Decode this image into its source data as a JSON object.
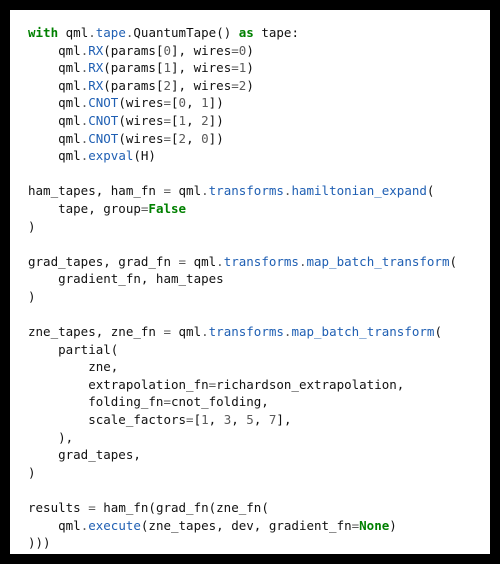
{
  "code": {
    "tokens": [
      [
        [
          "kw",
          "with "
        ],
        [
          "name",
          "qml"
        ],
        [
          "op",
          "."
        ],
        [
          "attr",
          "tape"
        ],
        [
          "op",
          "."
        ],
        [
          "name",
          "QuantumTape"
        ],
        [
          "punc",
          "() "
        ],
        [
          "kw",
          "as"
        ],
        [
          "name",
          " tape"
        ],
        [
          "punc",
          ":"
        ]
      ],
      [
        [
          "name",
          "    qml"
        ],
        [
          "op",
          "."
        ],
        [
          "call",
          "RX"
        ],
        [
          "punc",
          "(params["
        ],
        [
          "num",
          "0"
        ],
        [
          "punc",
          "], wires"
        ],
        [
          "op",
          "="
        ],
        [
          "num",
          "0"
        ],
        [
          "punc",
          ")"
        ]
      ],
      [
        [
          "name",
          "    qml"
        ],
        [
          "op",
          "."
        ],
        [
          "call",
          "RX"
        ],
        [
          "punc",
          "(params["
        ],
        [
          "num",
          "1"
        ],
        [
          "punc",
          "], wires"
        ],
        [
          "op",
          "="
        ],
        [
          "num",
          "1"
        ],
        [
          "punc",
          ")"
        ]
      ],
      [
        [
          "name",
          "    qml"
        ],
        [
          "op",
          "."
        ],
        [
          "call",
          "RX"
        ],
        [
          "punc",
          "(params["
        ],
        [
          "num",
          "2"
        ],
        [
          "punc",
          "], wires"
        ],
        [
          "op",
          "="
        ],
        [
          "num",
          "2"
        ],
        [
          "punc",
          ")"
        ]
      ],
      [
        [
          "name",
          "    qml"
        ],
        [
          "op",
          "."
        ],
        [
          "call",
          "CNOT"
        ],
        [
          "punc",
          "(wires"
        ],
        [
          "op",
          "="
        ],
        [
          "punc",
          "["
        ],
        [
          "num",
          "0"
        ],
        [
          "punc",
          ", "
        ],
        [
          "num",
          "1"
        ],
        [
          "punc",
          "])"
        ]
      ],
      [
        [
          "name",
          "    qml"
        ],
        [
          "op",
          "."
        ],
        [
          "call",
          "CNOT"
        ],
        [
          "punc",
          "(wires"
        ],
        [
          "op",
          "="
        ],
        [
          "punc",
          "["
        ],
        [
          "num",
          "1"
        ],
        [
          "punc",
          ", "
        ],
        [
          "num",
          "2"
        ],
        [
          "punc",
          "])"
        ]
      ],
      [
        [
          "name",
          "    qml"
        ],
        [
          "op",
          "."
        ],
        [
          "call",
          "CNOT"
        ],
        [
          "punc",
          "(wires"
        ],
        [
          "op",
          "="
        ],
        [
          "punc",
          "["
        ],
        [
          "num",
          "2"
        ],
        [
          "punc",
          ", "
        ],
        [
          "num",
          "0"
        ],
        [
          "punc",
          "])"
        ]
      ],
      [
        [
          "name",
          "    qml"
        ],
        [
          "op",
          "."
        ],
        [
          "call",
          "expval"
        ],
        [
          "punc",
          "(H)"
        ]
      ],
      [],
      [
        [
          "name",
          "ham_tapes, ham_fn "
        ],
        [
          "op",
          "="
        ],
        [
          "name",
          " qml"
        ],
        [
          "op",
          "."
        ],
        [
          "attr",
          "transforms"
        ],
        [
          "op",
          "."
        ],
        [
          "call",
          "hamiltonian_expand"
        ],
        [
          "punc",
          "("
        ]
      ],
      [
        [
          "name",
          "    tape, group"
        ],
        [
          "op",
          "="
        ],
        [
          "builtin_bold",
          "False"
        ]
      ],
      [
        [
          "punc",
          ")"
        ]
      ],
      [],
      [
        [
          "name",
          "grad_tapes, grad_fn "
        ],
        [
          "op",
          "="
        ],
        [
          "name",
          " qml"
        ],
        [
          "op",
          "."
        ],
        [
          "attr",
          "transforms"
        ],
        [
          "op",
          "."
        ],
        [
          "call",
          "map_batch_transform"
        ],
        [
          "punc",
          "("
        ]
      ],
      [
        [
          "name",
          "    gradient_fn, ham_tapes"
        ]
      ],
      [
        [
          "punc",
          ")"
        ]
      ],
      [],
      [
        [
          "name",
          "zne_tapes, zne_fn "
        ],
        [
          "op",
          "="
        ],
        [
          "name",
          " qml"
        ],
        [
          "op",
          "."
        ],
        [
          "attr",
          "transforms"
        ],
        [
          "op",
          "."
        ],
        [
          "call",
          "map_batch_transform"
        ],
        [
          "punc",
          "("
        ]
      ],
      [
        [
          "name",
          "    partial("
        ]
      ],
      [
        [
          "name",
          "        zne,"
        ]
      ],
      [
        [
          "name",
          "        extrapolation_fn"
        ],
        [
          "op",
          "="
        ],
        [
          "name",
          "richardson_extrapolation,"
        ]
      ],
      [
        [
          "name",
          "        folding_fn"
        ],
        [
          "op",
          "="
        ],
        [
          "name",
          "cnot_folding,"
        ]
      ],
      [
        [
          "name",
          "        scale_factors"
        ],
        [
          "op",
          "="
        ],
        [
          "punc",
          "["
        ],
        [
          "num",
          "1"
        ],
        [
          "punc",
          ", "
        ],
        [
          "num",
          "3"
        ],
        [
          "punc",
          ", "
        ],
        [
          "num",
          "5"
        ],
        [
          "punc",
          ", "
        ],
        [
          "num",
          "7"
        ],
        [
          "punc",
          "],"
        ]
      ],
      [
        [
          "name",
          "    ),"
        ]
      ],
      [
        [
          "name",
          "    grad_tapes,"
        ]
      ],
      [
        [
          "punc",
          ")"
        ]
      ],
      [],
      [
        [
          "name",
          "results "
        ],
        [
          "op",
          "="
        ],
        [
          "name",
          " ham_fn(grad_fn(zne_fn("
        ]
      ],
      [
        [
          "name",
          "    qml"
        ],
        [
          "op",
          "."
        ],
        [
          "call",
          "execute"
        ],
        [
          "punc",
          "(zne_tapes, dev, gradient_fn"
        ],
        [
          "op",
          "="
        ],
        [
          "builtin_bold",
          "None"
        ],
        [
          "punc",
          ")"
        ]
      ],
      [
        [
          "punc",
          ")))"
        ]
      ]
    ]
  }
}
